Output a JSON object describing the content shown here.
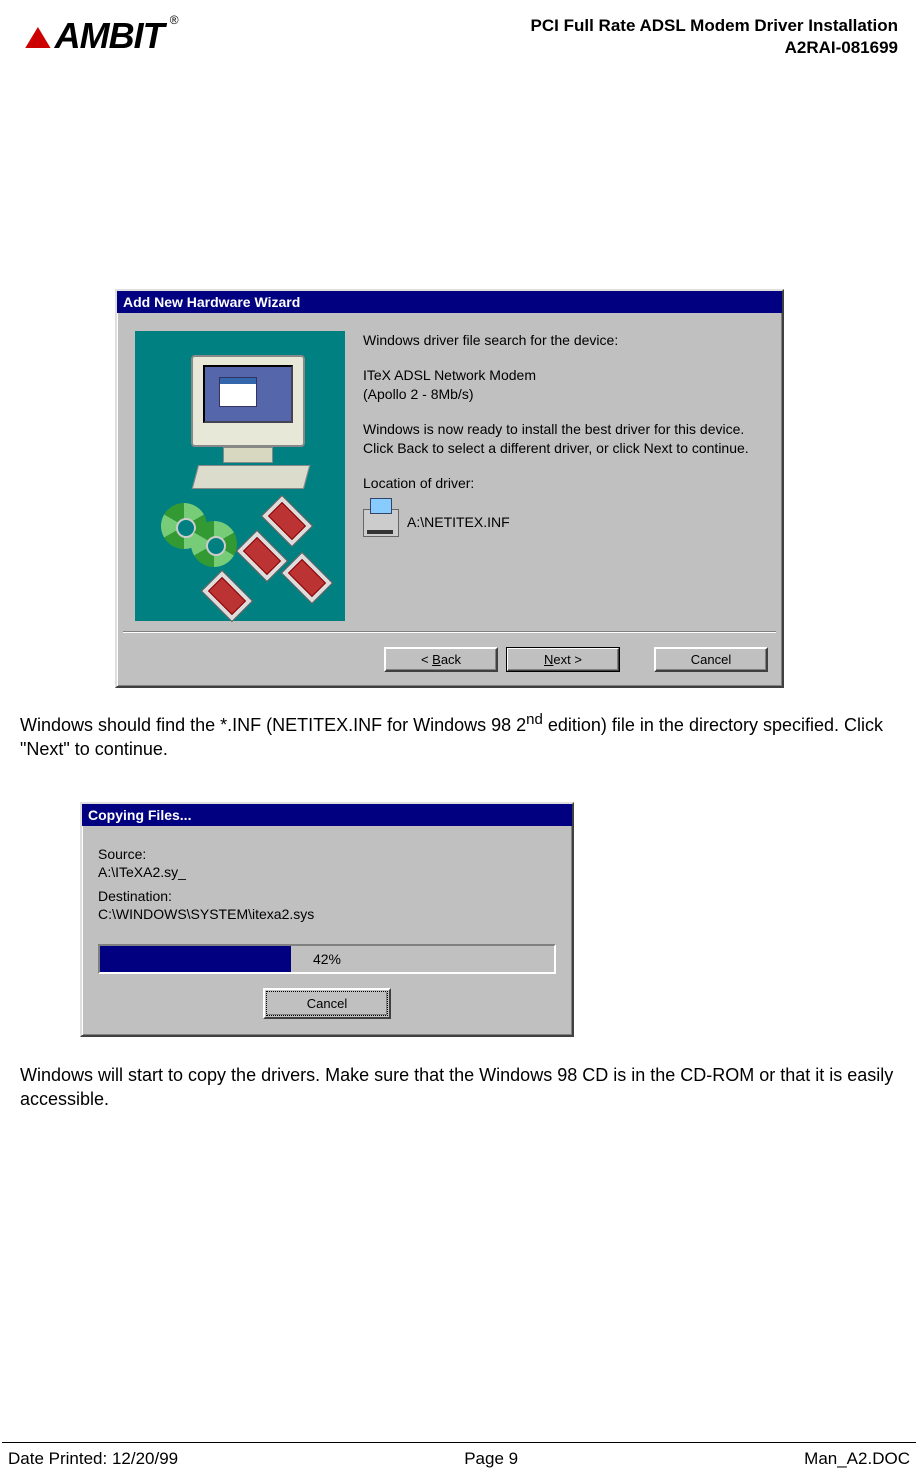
{
  "header": {
    "brand": "AMBIT",
    "reg": "®",
    "title_line1": "PCI Full Rate ADSL Modem Driver Installation",
    "title_line2": "A2RAI-081699"
  },
  "wizard": {
    "title": "Add New Hardware Wizard",
    "search_line": "Windows driver file search for the device:",
    "device_line1": "ITeX  ADSL Network Modem",
    "device_line2": "(Apollo 2 - 8Mb/s)",
    "ready_text": "Windows is now ready to install the best driver for this device. Click Back to select a different driver, or click Next to continue.",
    "location_label": "Location of driver:",
    "location_path": "A:\\NETITEX.INF",
    "buttons": {
      "back": "< Back",
      "next": "Next >",
      "cancel": "Cancel"
    }
  },
  "body_text_1a": "Windows should find the *.INF (NETITEX.INF for Windows 98 2",
  "body_text_1_sup": "nd",
  "body_text_1b": " edition) file in the directory specified.  Click \"Next\" to continue.",
  "copy_dialog": {
    "title": "Copying Files...",
    "source_label": "Source:",
    "source_value": "A:\\ITeXA2.sy_",
    "dest_label": "Destination:",
    "dest_value": "C:\\WINDOWS\\SYSTEM\\itexa2.sys",
    "progress_percent": 42,
    "progress_label": "42%",
    "cancel": "Cancel"
  },
  "body_text_2": "Windows will start to copy the drivers.  Make sure that the Windows 98 CD is in the CD-ROM or that it is easily accessible.",
  "footer": {
    "left_label": "Date Printed: ",
    "left_value": "12/20/99",
    "center": "Page 9",
    "right": "Man_A2.DOC"
  }
}
